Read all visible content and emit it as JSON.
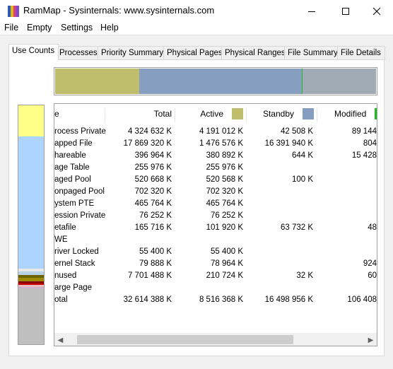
{
  "window": {
    "title": "RamMap - Sysinternals: www.sysinternals.com",
    "controls": [
      "minimize",
      "maximize",
      "close"
    ]
  },
  "menu": [
    "File",
    "Empty",
    "Settings",
    "Help"
  ],
  "tabs": [
    "Use Counts",
    "Processes",
    "Priority Summary",
    "Physical Pages",
    "Physical Ranges",
    "File Summary",
    "File Details"
  ],
  "active_tab": "Use Counts",
  "colors": {
    "active": "#bdbd6b",
    "standby": "#869fc0",
    "modified": "#22bb22",
    "transition": "#a0aab4",
    "sidebar_yellow": "#ffff88",
    "sidebar_blue": "#add3ff",
    "sidebar_gray": "#bfbfbf"
  },
  "usage_bar": [
    {
      "name": "active",
      "fraction": 0.262
    },
    {
      "name": "standby",
      "fraction": 0.506
    },
    {
      "name": "modified",
      "fraction": 0.004
    },
    {
      "name": "transition",
      "fraction": 0.228
    }
  ],
  "table": {
    "columns": [
      {
        "label": "e"
      },
      {
        "label": "Total"
      },
      {
        "label": "Active",
        "swatch": "#bdbd6b"
      },
      {
        "label": "Standby",
        "swatch": "#869fc0"
      },
      {
        "label": "Modified",
        "swatch": "#22bb22"
      }
    ],
    "rows": [
      [
        "rocess Private",
        "4 324 632 K",
        "4 191 012 K",
        "42 508 K",
        "89 144"
      ],
      [
        "apped File",
        "17 869 320 K",
        "1 476 576 K",
        "16 391 940 K",
        "804"
      ],
      [
        "hareable",
        "396 964 K",
        "380 892 K",
        "644 K",
        "15 428"
      ],
      [
        "age Table",
        "255 976 K",
        "255 976 K",
        "",
        ""
      ],
      [
        "aged Pool",
        "520 668 K",
        "520 568 K",
        "100 K",
        ""
      ],
      [
        "onpaged Pool",
        "702 320 K",
        "702 320 K",
        "",
        ""
      ],
      [
        "ystem PTE",
        "465 764 K",
        "465 764 K",
        "",
        ""
      ],
      [
        "ession Private",
        "76 252 K",
        "76 252 K",
        "",
        ""
      ],
      [
        "etafile",
        "165 716 K",
        "101 920 K",
        "63 732 K",
        "48"
      ],
      [
        "WE",
        "",
        "",
        "",
        ""
      ],
      [
        "river Locked",
        "55 400 K",
        "55 400 K",
        "",
        ""
      ],
      [
        "ernel Stack",
        "79 888 K",
        "78 964 K",
        "",
        "924"
      ],
      [
        "nused",
        "7 701 488 K",
        "210 724 K",
        "32 K",
        "60"
      ],
      [
        "arge Page",
        "",
        "",
        "",
        ""
      ],
      [
        "otal",
        "32 614 388 K",
        "8 516 368 K",
        "16 498 956 K",
        "106 408"
      ]
    ]
  }
}
